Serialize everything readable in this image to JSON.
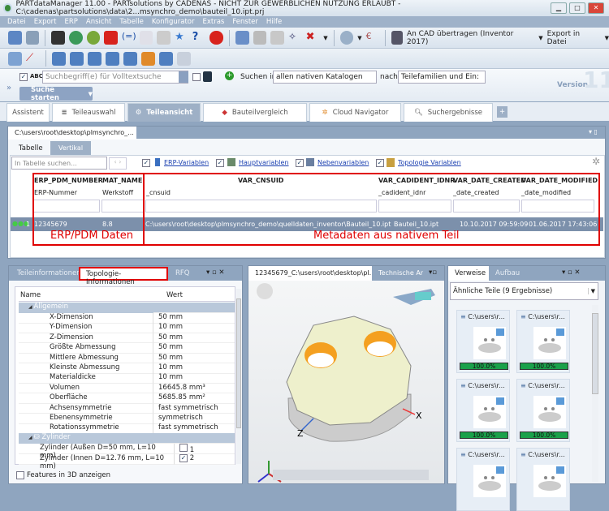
{
  "window": {
    "title": "PARTdataManager 11.00 - PARTsolutions by CADENAS - NICHT ZUR GEWERBLICHEN NUTZUNG ERLAUBT - C:\\cadenas\\partsolutions\\data\\2...msynchro_demo\\bauteil_10.ipt.prj"
  },
  "menu": [
    "Datei",
    "Export",
    "ERP",
    "Ansicht",
    "Tabelle",
    "Konfigurator",
    "Extras",
    "Fenster",
    "Hilfe"
  ],
  "toolbar": {
    "cad_transfer": "An CAD übertragen (Inventor 2017)",
    "export_file": "Export in Datei"
  },
  "search": {
    "abc": "ABC",
    "placeholder": "Suchbegriff(e) für Volltextsuche",
    "search_in": "Suchen in",
    "catalogs": "allen nativen Katalogen",
    "by": "nach",
    "families": "Teilefamilien und Ein:",
    "start": "Suche starten",
    "version": "Version",
    "version_num": "11"
  },
  "tabs": [
    "Assistent",
    "Teileauswahl",
    "Teileansicht",
    "Bauteilvergleich",
    "Cloud Navigator",
    "Suchergebnisse"
  ],
  "table_panel": {
    "title": "C:\\users\\root\\desktop\\plmsynchro_...",
    "subtabs": [
      "Tabelle",
      "Vertikal"
    ],
    "search_placeholder": "In Tabelle suchen...",
    "filters": [
      "ERP-Variablen",
      "Hauptvariablen",
      "Nebenvariablen",
      "Topologie Variablen"
    ],
    "columns": [
      {
        "name": "ERP_PDM_NUMBER",
        "sub": "ERP-Nummer"
      },
      {
        "name": "MAT_NAME",
        "sub": "Werkstoff"
      },
      {
        "name": "VAR_CNSUID",
        "sub": "_cnsuid"
      },
      {
        "name": "VAR_CADIDENT_IDNR",
        "sub": "_cadident_idnr"
      },
      {
        "name": "VAR_DATE_CREATED",
        "sub": "_date_created"
      },
      {
        "name": "VAR_DATE_MODIFIED",
        "sub": "_date_modified"
      }
    ],
    "row": {
      "index": "1",
      "values": [
        "12345679",
        "8.8",
        "C:\\users\\root\\desktop\\plmsynchro_demo\\quelldaten_inventor\\Bauteil_10.ipt",
        "Bauteil_10.ipt",
        "10.10.2017 09:59:09",
        "01.06.2017 17:43:06"
      ]
    },
    "annotations": [
      "ERP/PDM Daten",
      "Metadaten aus nativem Teil"
    ]
  },
  "topo_panel": {
    "tabs": [
      "Teileinformationen",
      "Topologie-Informationen",
      "RFQ"
    ],
    "headers": [
      "Name",
      "Wert"
    ],
    "group1": "Allgemein",
    "rows": [
      [
        "X-Dimension",
        "50 mm"
      ],
      [
        "Y-Dimension",
        "10 mm"
      ],
      [
        "Z-Dimension",
        "50 mm"
      ],
      [
        "Größte Abmessung",
        "50 mm"
      ],
      [
        "Mittlere Abmessung",
        "50 mm"
      ],
      [
        "Kleinste Abmessung",
        "10 mm"
      ],
      [
        "Materialdicke",
        "10 mm"
      ],
      [
        "Volumen",
        "16645.8 mm³"
      ],
      [
        "Oberfläche",
        "5685.85 mm²"
      ],
      [
        "Achsensymmetrie",
        "fast symmetrisch"
      ],
      [
        "Ebenensymmetrie",
        "symmetrisch"
      ],
      [
        "Rotationssymmetrie",
        "fast symmetrisch"
      ]
    ],
    "group2": "Zylinder",
    "cyl": [
      [
        "Zylinder (Außen D=50 mm, L=10 mm)",
        "1",
        false
      ],
      [
        "Zylinder (Innen D=12.76 mm, L=10 mm)",
        "2",
        true
      ]
    ],
    "features3d": "Features in 3D anzeigen"
  },
  "view_panel": {
    "tab": "12345679_C:\\users\\root\\desktop\\pl...",
    "tab2": "Technische Ar",
    "axis_x": "X",
    "axis_z": "Z"
  },
  "ref_panel": {
    "tabs": [
      "Verweise",
      "Aufbau"
    ],
    "select": "Ähnliche Teile (9 Ergebnisse)",
    "cards": [
      {
        "label": "C:\\users\\r...",
        "score": "100.0%"
      },
      {
        "label": "C:\\users\\r...",
        "score": "100.0%"
      },
      {
        "label": "C:\\users\\r...",
        "score": "100.0%"
      },
      {
        "label": "C:\\users\\r...",
        "score": "100.0%"
      },
      {
        "label": "C:\\users\\r...",
        "score": ""
      },
      {
        "label": "C:\\users\\r...",
        "score": ""
      }
    ]
  }
}
